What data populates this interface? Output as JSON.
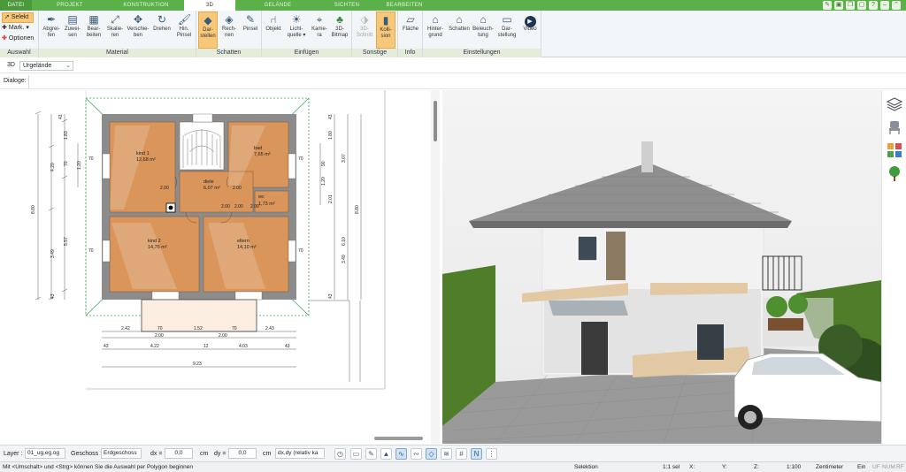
{
  "tabs": [
    {
      "label": "DATEI",
      "active": false
    },
    {
      "label": "PROJEKT",
      "active": false
    },
    {
      "label": "KONSTRUKTION",
      "active": false
    },
    {
      "label": "3D",
      "active": true
    },
    {
      "label": "GELÄNDE",
      "active": false
    },
    {
      "label": "SICHTEN",
      "active": false
    },
    {
      "label": "BEARBEITEN",
      "active": false
    }
  ],
  "ribbon": {
    "auswahl": {
      "label": "Auswahl",
      "items": [
        {
          "label": "Selekt",
          "icon": "cursor-icon",
          "selected": true
        },
        {
          "label": "Mark.",
          "icon": "mark-icon",
          "selected": false
        },
        {
          "label": "Optionen",
          "icon": "plus-icon",
          "selected": false
        }
      ]
    },
    "material": {
      "label": "Material",
      "buttons": [
        {
          "line1": "Abgrei-",
          "line2": "fen",
          "icon": "pipette-icon"
        },
        {
          "line1": "Zuwei-",
          "line2": "sen",
          "icon": "assign-icon"
        },
        {
          "line1": "Bear-",
          "line2": "beiten",
          "icon": "edit-icon"
        },
        {
          "line1": "Skalie-",
          "line2": "ren",
          "icon": "scale-icon"
        },
        {
          "line1": "Verschie-",
          "line2": "ben",
          "icon": "move-icon"
        },
        {
          "line1": "Drehen",
          "line2": "",
          "icon": "rotate-icon"
        },
        {
          "line1": "Hin.",
          "line2": "Pinsel",
          "icon": "brush-icon"
        }
      ]
    },
    "schatten": {
      "label": "Schatten",
      "buttons": [
        {
          "line1": "Dar-",
          "line2": "stellen",
          "icon": "cube-icon",
          "active": true
        },
        {
          "line1": "Rech-",
          "line2": "nen",
          "icon": "cube-calc-icon"
        },
        {
          "line1": "Pinsel",
          "line2": "",
          "icon": "brush-icon"
        }
      ]
    },
    "einfuegen": {
      "label": "Einfügen",
      "buttons": [
        {
          "line1": "Objekt",
          "line2": "",
          "icon": "chair-icon"
        },
        {
          "line1": "Licht-",
          "line2": "quelle ▾",
          "icon": "bulb-icon"
        },
        {
          "line1": "Kame-",
          "line2": "ra",
          "icon": "camera-icon"
        },
        {
          "line1": "3D-",
          "line2": "Bitmap",
          "icon": "tree-icon"
        }
      ]
    },
    "sonstige": {
      "label": "Sonstige",
      "buttons": [
        {
          "line1": "3D-",
          "line2": "Schnitt",
          "icon": "cut-icon",
          "disabled": true
        },
        {
          "line1": "Kolli-",
          "line2": "sion",
          "icon": "collision-icon",
          "active": true
        }
      ]
    },
    "info": {
      "label": "Info",
      "buttons": [
        {
          "line1": "Fläche",
          "line2": "",
          "icon": "area-icon"
        }
      ]
    },
    "einstellungen": {
      "label": "Einstellungen",
      "buttons": [
        {
          "line1": "Hinter-",
          "line2": "grund",
          "icon": "background-icon"
        },
        {
          "line1": "Schatten",
          "line2": "",
          "icon": "house-shadow-icon"
        },
        {
          "line1": "Beleuch-",
          "line2": "tung",
          "icon": "house-light-icon"
        },
        {
          "line1": "Dar-",
          "line2": "stellung",
          "icon": "monitor-icon"
        },
        {
          "line1": "Video",
          "line2": "",
          "icon": "play-icon"
        }
      ]
    }
  },
  "view_row": {
    "label": "3D",
    "select": "Urgelände"
  },
  "dialog_row": {
    "label": "Dialoge:"
  },
  "plan": {
    "rooms": [
      {
        "name": "kind 1",
        "area": "12,68 m²"
      },
      {
        "name": "bad",
        "area": "7,65 m²"
      },
      {
        "name": "diele",
        "area": "6,07 m²"
      },
      {
        "name": "wc",
        "area": "1,73 m²"
      },
      {
        "name": "kind 2",
        "area": "14,76 m²"
      },
      {
        "name": "eltern",
        "area": "14,10 m²"
      }
    ],
    "dims_left": [
      "43",
      "1.83",
      "4.20",
      "70",
      "1.20",
      "8.80",
      "5.57",
      "3.49",
      "43"
    ],
    "dims_right": [
      "43",
      "1.80",
      "3.07",
      "90",
      "1.20",
      "2.01",
      "8.80",
      "6.10",
      "3.49",
      "43"
    ],
    "dims_bottom": [
      "2.42",
      "70",
      "1.52",
      "70",
      "2.43",
      "2.00",
      "2.00",
      "43",
      "4.22",
      "12",
      "4.03",
      "43",
      "9.23"
    ],
    "door_dims": [
      "2.00",
      "2.00",
      "2.00",
      "2.00",
      "2.00",
      "70",
      "70",
      "70",
      "70"
    ]
  },
  "bottombar": {
    "layer_label": "Layer :",
    "layer_value": "01_ug.eg.og",
    "geschoss_label": "Geschoss :",
    "geschoss_value": "Erdgeschoss",
    "dx_label": "dx =",
    "dx_value": "0,0",
    "dx_unit": "cm",
    "dy_label": "dy =",
    "dy_value": "0,0",
    "dy_unit": "cm",
    "mode_value": "dx,dy (relativ ka"
  },
  "statusbar": {
    "hint": "Mit <Umschalt> und <Strg> können Sie die Auswahl per Polygon beginnen",
    "mode": "Selektion",
    "ratio": "1:1 sel",
    "x": "X:",
    "y": "Y:",
    "z": "Z:",
    "scale": "1:100",
    "unit": "Zentimeter",
    "ein": "Ein",
    "flags": [
      "UF",
      "NUM",
      "RF"
    ]
  },
  "colors": {
    "tab_green": "#5bb04a",
    "room_floor": "#d9955a",
    "wall": "#8c8c8c",
    "active_button": "#f7c77a"
  }
}
